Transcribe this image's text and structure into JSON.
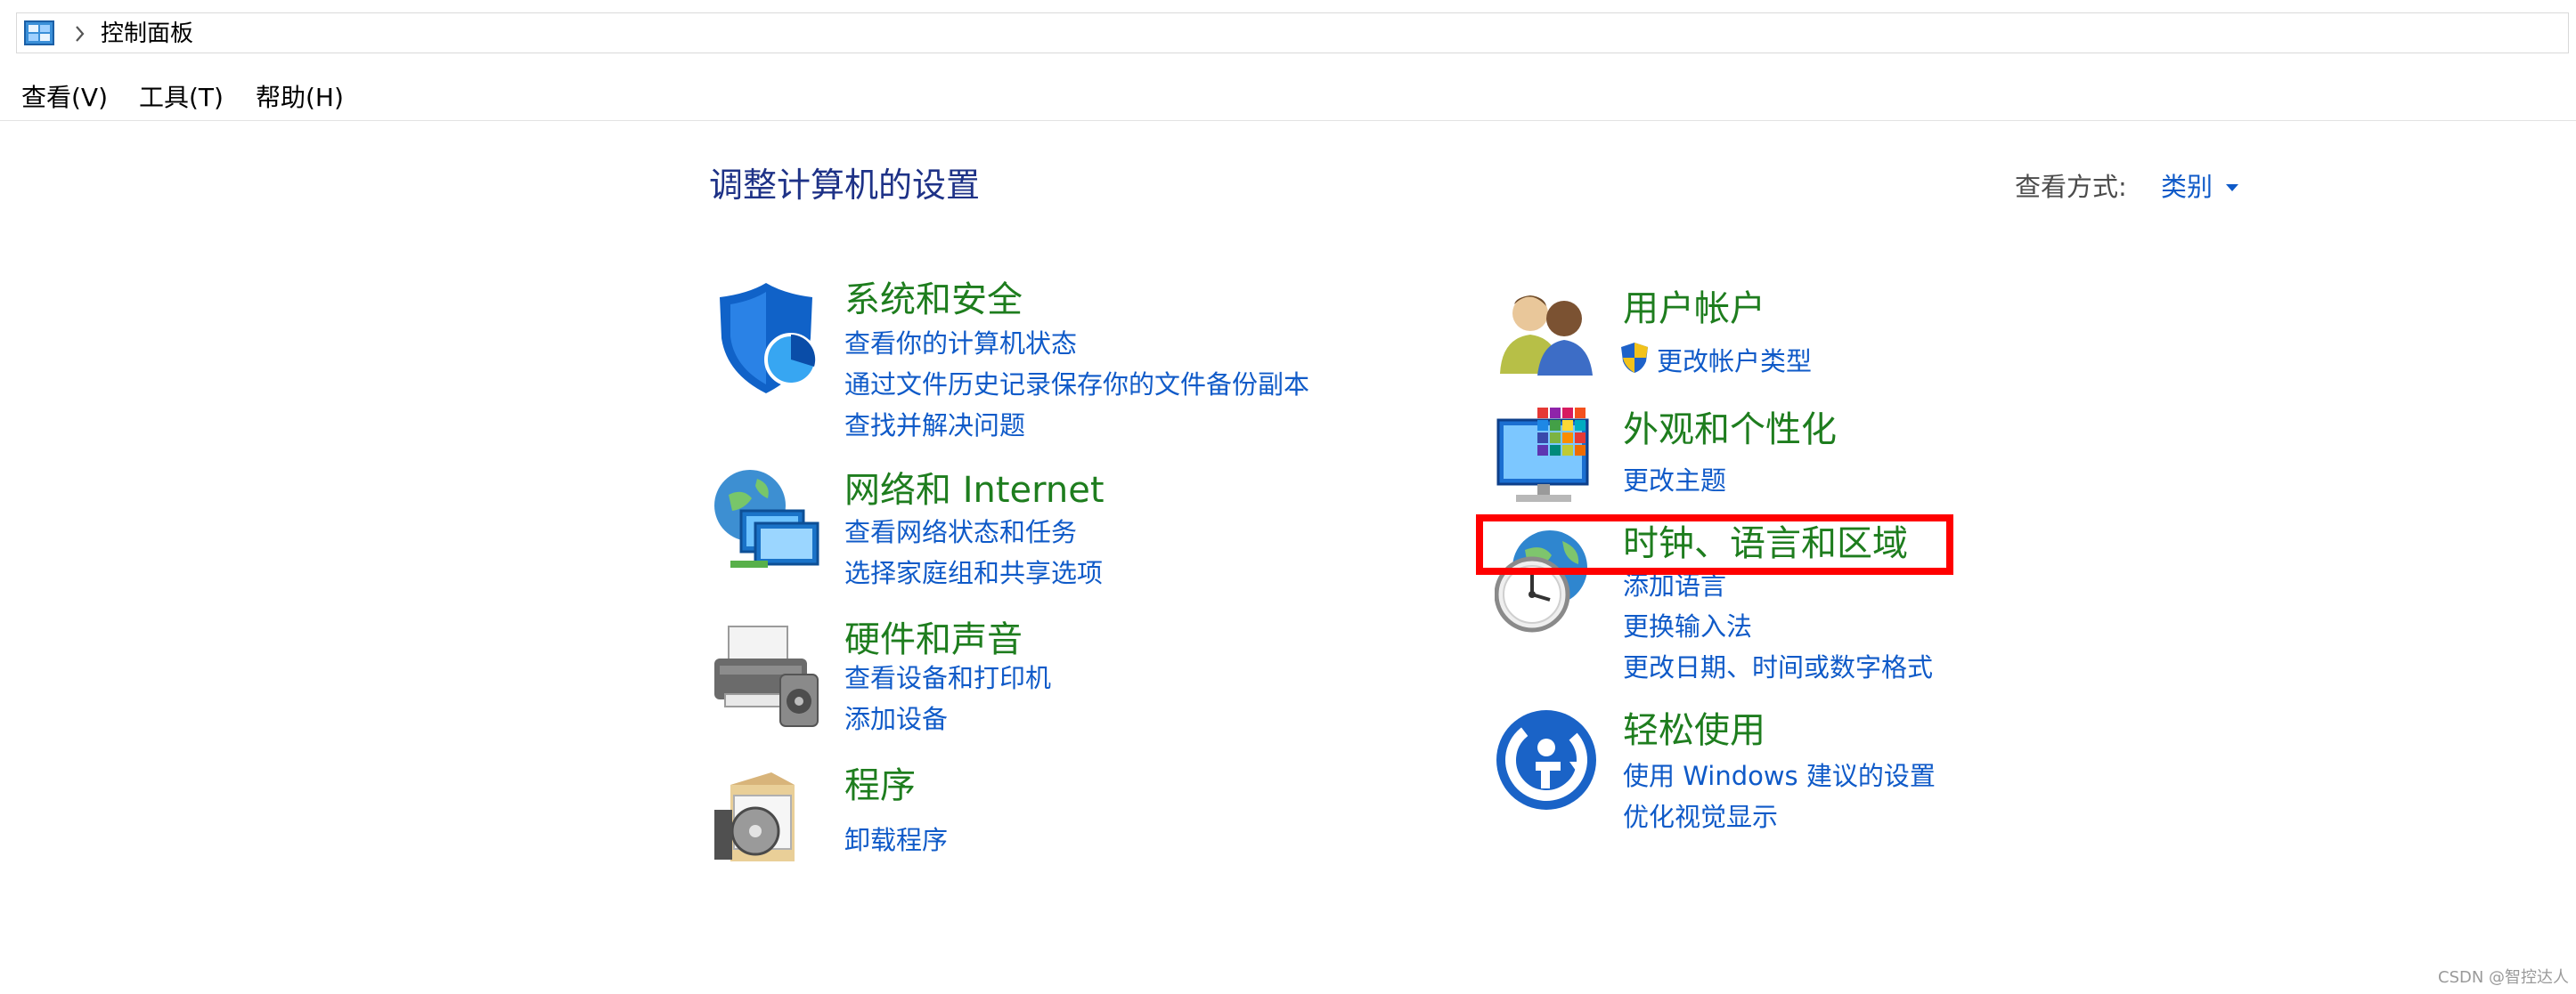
{
  "address_bar": {
    "breadcrumb": "控制面板"
  },
  "menu": {
    "items": [
      "查看(V)",
      "工具(T)",
      "帮助(H)"
    ]
  },
  "header": {
    "title": "调整计算机的设置",
    "view_by_label": "查看方式:",
    "view_by_value": "类别"
  },
  "categories": {
    "system_security": {
      "title": "系统和安全",
      "links": [
        "查看你的计算机状态",
        "通过文件历史记录保存你的文件备份副本",
        "查找并解决问题"
      ]
    },
    "network_internet": {
      "title": "网络和 Internet",
      "links": [
        "查看网络状态和任务",
        "选择家庭组和共享选项"
      ]
    },
    "hardware_sound": {
      "title": "硬件和声音",
      "links": [
        "查看设备和打印机",
        "添加设备"
      ]
    },
    "programs": {
      "title": "程序",
      "links": [
        "卸载程序"
      ]
    },
    "user_accounts": {
      "title": "用户帐户",
      "links": [
        "更改帐户类型"
      ]
    },
    "appearance": {
      "title": "外观和个性化",
      "links": [
        "更改主题"
      ]
    },
    "clock_region": {
      "title": "时钟、语言和区域",
      "links": [
        "添加语言",
        "更换输入法",
        "更改日期、时间或数字格式"
      ]
    },
    "ease_of_access": {
      "title": "轻松使用",
      "links": [
        "使用 Windows 建议的设置",
        "优化视觉显示"
      ]
    }
  },
  "watermark": "CSDN @智控达人",
  "colors": {
    "title_blue": "#1e3287",
    "link_blue": "#0f5ac8",
    "category_green": "#1e7d1e",
    "highlight_red": "#ff0000"
  }
}
